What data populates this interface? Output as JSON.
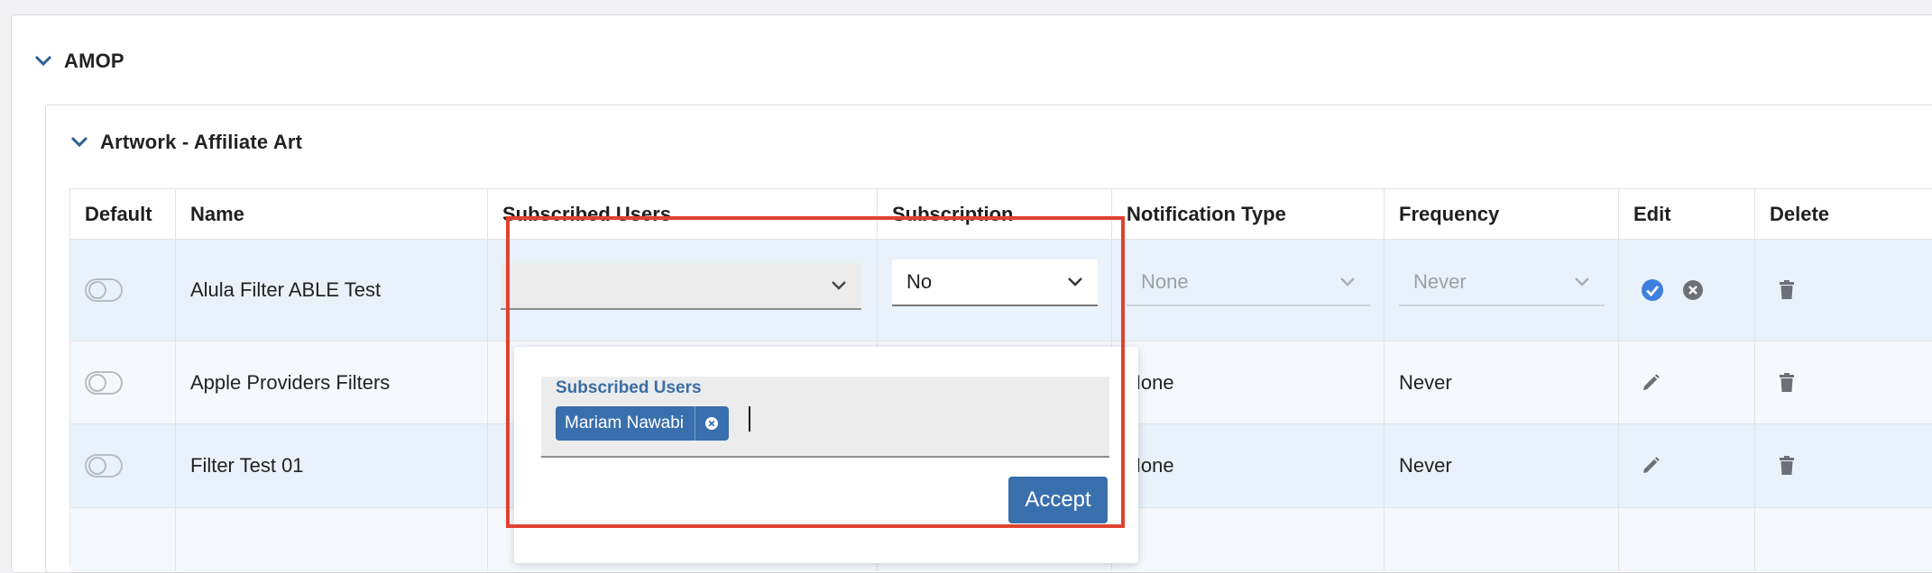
{
  "sections": {
    "outer_title": "AMOP",
    "inner_title": "Artwork - Affiliate Art"
  },
  "table": {
    "headers": {
      "default": "Default",
      "name": "Name",
      "subscribed_users": "Subscribed Users",
      "subscription": "Subscription",
      "notification_type": "Notification Type",
      "frequency": "Frequency",
      "edit": "Edit",
      "delete": "Delete"
    },
    "rows": [
      {
        "name": "Alula Filter ABLE Test",
        "subscription": "No",
        "notification_type": "None",
        "frequency": "Never"
      },
      {
        "name": "Apple Providers Filters",
        "notification_type": "None",
        "frequency": "Never"
      },
      {
        "name": "Filter Test 01",
        "notification_type": "None",
        "frequency": "Never"
      }
    ]
  },
  "dropdown": {
    "field_label": "Subscribed Users",
    "chips": [
      "Mariam Nawabi"
    ],
    "accept_label": "Accept"
  },
  "colors": {
    "accent": "#3a6fad",
    "highlight": "#e0422f",
    "row_blue": "#e9f2fb",
    "row_light": "#f5f9fd"
  },
  "icons": {
    "collapse": "chevron-down-icon",
    "confirm": "check-circle-icon",
    "cancel": "close-circle-icon",
    "edit": "pencil-icon",
    "delete": "trash-icon",
    "remove_chip": "close-circle-icon"
  }
}
